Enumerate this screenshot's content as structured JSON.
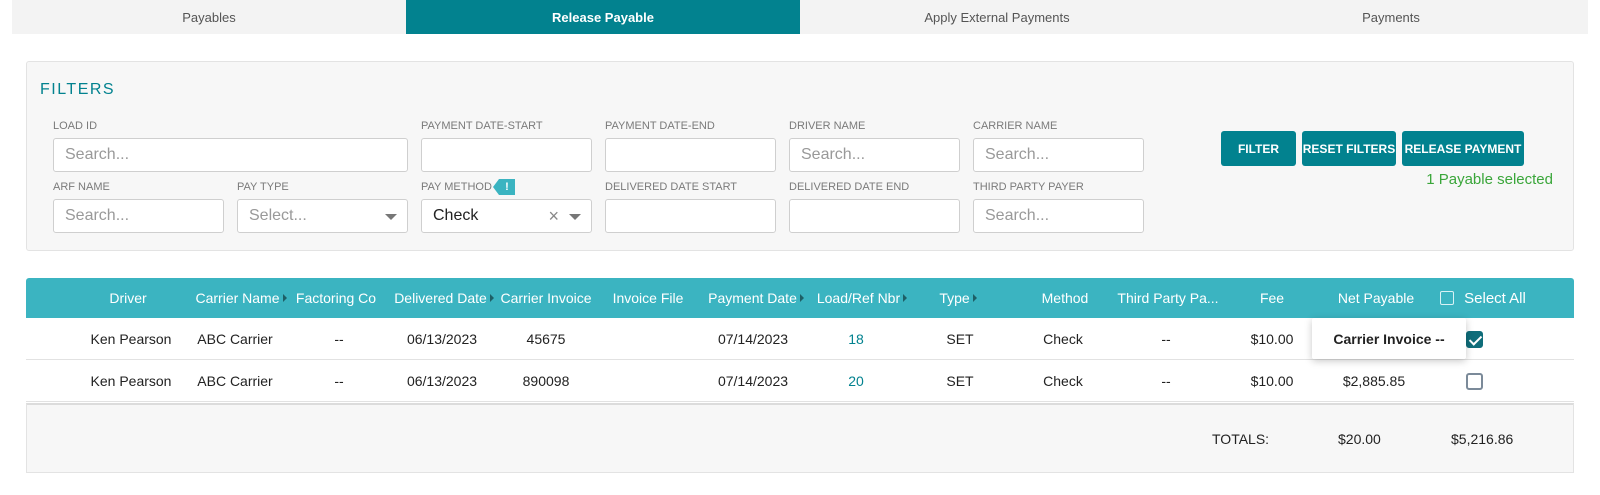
{
  "tabs": [
    {
      "label": "Payables"
    },
    {
      "label": "Release Payable"
    },
    {
      "label": "Apply External Payments"
    },
    {
      "label": "Payments"
    }
  ],
  "filters": {
    "title": "FILTERS",
    "load_id": {
      "label": "LOAD ID",
      "placeholder": "Search..."
    },
    "payment_date_start": {
      "label": "PAYMENT DATE-START",
      "value": ""
    },
    "payment_date_end": {
      "label": "PAYMENT DATE-END",
      "value": ""
    },
    "driver_name": {
      "label": "DRIVER NAME",
      "placeholder": "Search..."
    },
    "carrier_name": {
      "label": "CARRIER NAME",
      "placeholder": "Search..."
    },
    "arf_name": {
      "label": "ARF NAME",
      "placeholder": "Search..."
    },
    "pay_type": {
      "label": "PAY TYPE",
      "placeholder": "Select..."
    },
    "pay_method": {
      "label": "PAY METHOD",
      "value": "Check",
      "badge": "!"
    },
    "delivered_date_start": {
      "label": "DELIVERED DATE START",
      "value": ""
    },
    "delivered_date_end": {
      "label": "DELIVERED DATE END",
      "value": ""
    },
    "third_party_payer": {
      "label": "THIRD PARTY PAYER",
      "placeholder": "Search..."
    }
  },
  "buttons": {
    "filter": "FILTER",
    "reset": "RESET FILTERS",
    "release": "RELEASE PAYMENT"
  },
  "selected_note": "1 Payable selected",
  "table": {
    "columns": [
      "Driver",
      "Carrier Name",
      "Factoring Co",
      "Delivered Date",
      "Carrier Invoice",
      "Invoice File",
      "Payment Date",
      "Load/Ref Nbr",
      "Type",
      "Method",
      "Third Party Pa...",
      "Fee",
      "Net Payable",
      "Select All"
    ],
    "rows": [
      {
        "driver": "Ken Pearson",
        "carrier": "ABC Carrier",
        "factoring": "--",
        "delivered": "06/13/2023",
        "invoice": "45675",
        "invoice_file": "",
        "payment_date": "07/14/2023",
        "load_ref": "18",
        "type": "SET",
        "method": "Check",
        "third_party": "--",
        "fee": "$10.00",
        "net": "",
        "selected": true
      },
      {
        "driver": "Ken Pearson",
        "carrier": "ABC Carrier",
        "factoring": "--",
        "delivered": "06/13/2023",
        "invoice": "890098",
        "invoice_file": "",
        "payment_date": "07/14/2023",
        "load_ref": "20",
        "type": "SET",
        "method": "Check",
        "third_party": "--",
        "fee": "$10.00",
        "net": "$2,885.85",
        "selected": false
      }
    ]
  },
  "tooltip": "Carrier Invoice --",
  "totals": {
    "label": "TOTALS:",
    "fee": "$20.00",
    "net": "$5,216.86"
  },
  "colors": {
    "primary": "#02828f",
    "header": "#3bb4c1",
    "success": "#3aa63a"
  }
}
